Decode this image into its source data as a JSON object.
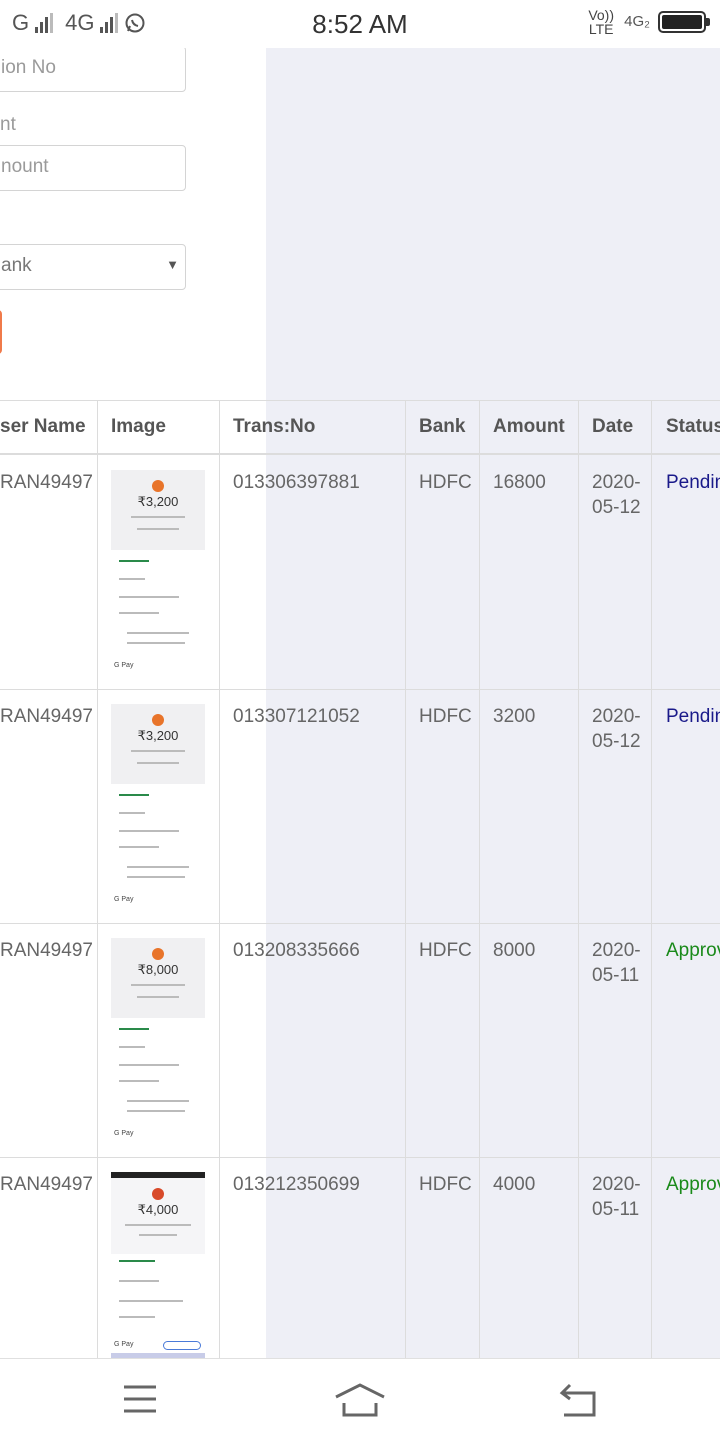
{
  "status_bar": {
    "carrier1": "G",
    "carrier2": "4G",
    "time": "8:52 AM",
    "volte": "Vo)) LTE",
    "net": "4G₂"
  },
  "form": {
    "transaction_no_placeholder": "ion No",
    "amount_label": "nt",
    "amount_placeholder": "nount",
    "bank_select_value": "ank",
    "select_arrow": "▼"
  },
  "table": {
    "headers": [
      "ser Name",
      "Image",
      "Trans:No",
      "Bank",
      "Amount",
      "Date",
      "Status"
    ],
    "rows": [
      {
        "user": "RAN49497",
        "thumb_amount": "₹3,200",
        "trans_no": "013306397881",
        "bank": "HDFC",
        "amount": "16800",
        "date1": "2020-",
        "date2": "05-12",
        "status": "Pendin",
        "status_type": "pending"
      },
      {
        "user": "RAN49497",
        "thumb_amount": "₹3,200",
        "trans_no": "013307121052",
        "bank": "HDFC",
        "amount": "3200",
        "date1": "2020-",
        "date2": "05-12",
        "status": "Pendin",
        "status_type": "pending"
      },
      {
        "user": "RAN49497",
        "thumb_amount": "₹8,000",
        "trans_no": "013208335666",
        "bank": "HDFC",
        "amount": "8000",
        "date1": "2020-",
        "date2": "05-11",
        "status": "Approv",
        "status_type": "approved"
      },
      {
        "user": "RAN49497",
        "thumb_amount": "₹4,000",
        "trans_no": "013212350699",
        "bank": "HDFC",
        "amount": "4000",
        "date1": "2020-",
        "date2": "05-11",
        "status": "Approv",
        "status_type": "approved"
      }
    ],
    "thumb_footer": "G Pay"
  },
  "colors": {
    "pending": "#1a1a8a",
    "approved": "#1a8a1a",
    "accent": "#f07a4a"
  },
  "navbar": {
    "icons": [
      "menu-icon",
      "home-icon",
      "back-icon"
    ]
  }
}
